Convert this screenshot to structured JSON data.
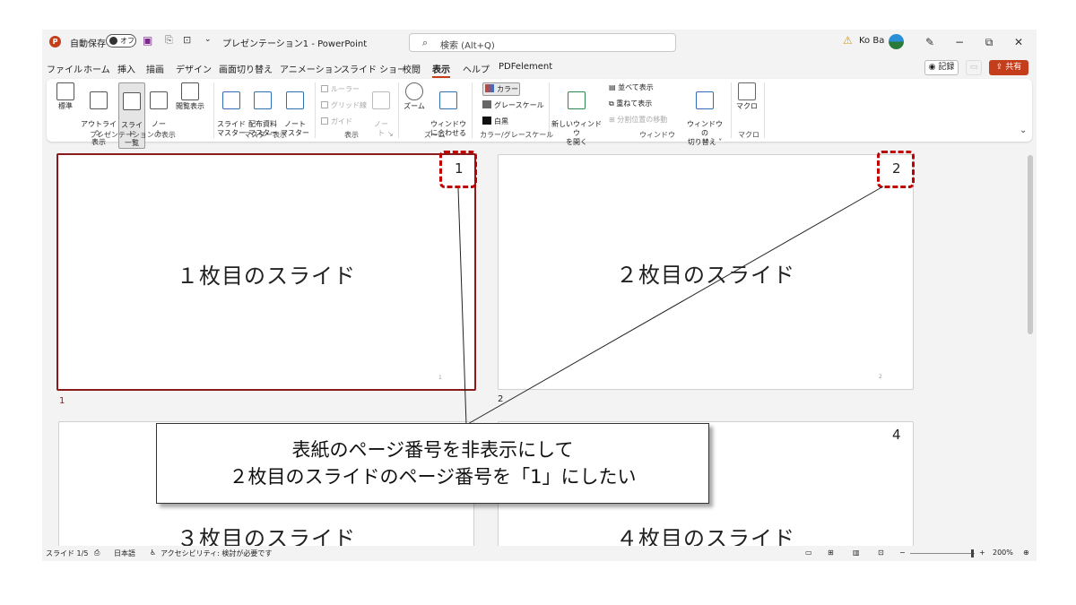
{
  "titlebar": {
    "logo_letter": "P",
    "autosave_label": "自動保存",
    "autosave_state": "オフ",
    "doc_title": "プレゼンテーション1 - PowerPoint",
    "search_placeholder": "検索 (Alt+Q)",
    "user_name": "Ko Ba"
  },
  "menu": {
    "items": [
      "ファイル",
      "ホーム",
      "挿入",
      "描画",
      "デザイン",
      "画面切り替え",
      "アニメーション",
      "スライド ショー",
      "校閲",
      "表示",
      "ヘルプ",
      "PDFelement"
    ],
    "active_index": 9,
    "record_label": "記録",
    "share_label": "共有"
  },
  "ribbon": {
    "buttons": {
      "normal": "標準",
      "outline": "アウトライン\n表示",
      "sorter": "スライド\n一覧",
      "notes": "ノー\nト",
      "reading": "閲覧表示",
      "slide_master": "スライド\nマスター",
      "handout_master": "配布資料\nマスター",
      "notes_master": "ノート\nマスター",
      "notes_disabled": "ノー\nト",
      "zoom": "ズーム",
      "fit_window": "ウィンドウ\nに合わせる",
      "new_window": "新しいウィンドウ\nを開く",
      "switch_window": "ウィンドウの\n切り替え ˅",
      "macro": "マクロ"
    },
    "checkboxes": {
      "ruler": "ルーラー",
      "grid": "グリッド線",
      "guide": "ガイド"
    },
    "color": {
      "color": "カラー",
      "grayscale": "グレースケール",
      "bw": "白黒"
    },
    "window_small": {
      "arrange": "並べて表示",
      "cascade": "重ねて表示",
      "move_split": "分割位置の移動"
    },
    "groups": {
      "presentation_views": "プレゼンテーションの表示",
      "master_views": "マスター表示",
      "show": "表示",
      "zoom": "ズーム",
      "color_gray": "カラー/グレースケール",
      "window": "ウィンドウ",
      "macro": "マクロ"
    }
  },
  "slides": [
    {
      "text": "１枚目のスライド",
      "header_number": "1",
      "footer_number": "1",
      "index_label": "1"
    },
    {
      "text": "２枚目のスライド",
      "header_number": "2",
      "footer_number": "2",
      "index_label": "2"
    },
    {
      "text": "３枚目のスライド",
      "header_number": "",
      "footer_number": "",
      "index_label": ""
    },
    {
      "text": "４枚目のスライド",
      "header_number": "4",
      "footer_number": "",
      "index_label": ""
    }
  ],
  "callout": {
    "line1": "表紙のページ番号を非表示にして",
    "line2": "２枚目のスライドのページ番号を「1」にしたい"
  },
  "status": {
    "slide_info": "スライド 1/5",
    "language": "日本語",
    "accessibility": "アクセシビリティ: 検討が必要です",
    "zoom": "200%"
  },
  "colors": {
    "accent": "#c43e1c",
    "selected_border": "#8b1a1a",
    "highlight_dashed": "#c00000"
  }
}
